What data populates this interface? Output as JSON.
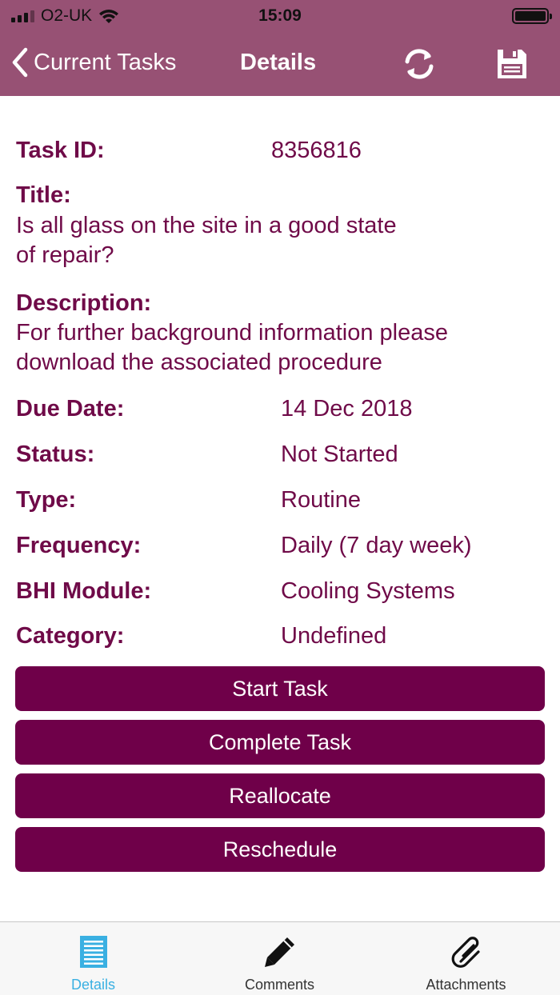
{
  "status_bar": {
    "carrier": "O2-UK",
    "time": "15:09"
  },
  "nav": {
    "back_label": "Current Tasks",
    "title": "Details"
  },
  "task": {
    "task_id_label": "Task ID:",
    "task_id": "8356816",
    "title_label": "Title:",
    "title_line1": "Is all glass on the site in a good state",
    "title_line2": "of repair?",
    "description_label": "Description:",
    "description_line1": "For further background information please",
    "description_line2": "download the associated procedure",
    "fields": [
      {
        "label": "Due Date:",
        "value": "14 Dec 2018"
      },
      {
        "label": "Status:",
        "value": "Not Started"
      },
      {
        "label": "Type:",
        "value": "Routine"
      },
      {
        "label": "Frequency:",
        "value": "Daily (7 day week)"
      },
      {
        "label": "BHI Module:",
        "value": "Cooling Systems"
      },
      {
        "label": "Category:",
        "value": "Undefined"
      }
    ]
  },
  "actions": {
    "start": "Start Task",
    "complete": "Complete Task",
    "reallocate": "Reallocate",
    "reschedule": "Reschedule"
  },
  "tabs": [
    {
      "label": "Details",
      "icon": "list-icon",
      "active": true
    },
    {
      "label": "Comments",
      "icon": "pencil-icon",
      "active": false
    },
    {
      "label": "Attachments",
      "icon": "paperclip-icon",
      "active": false
    }
  ],
  "colors": {
    "nav_background": "#975174",
    "accent": "#6f0049",
    "active_tab": "#3ab0e2"
  }
}
